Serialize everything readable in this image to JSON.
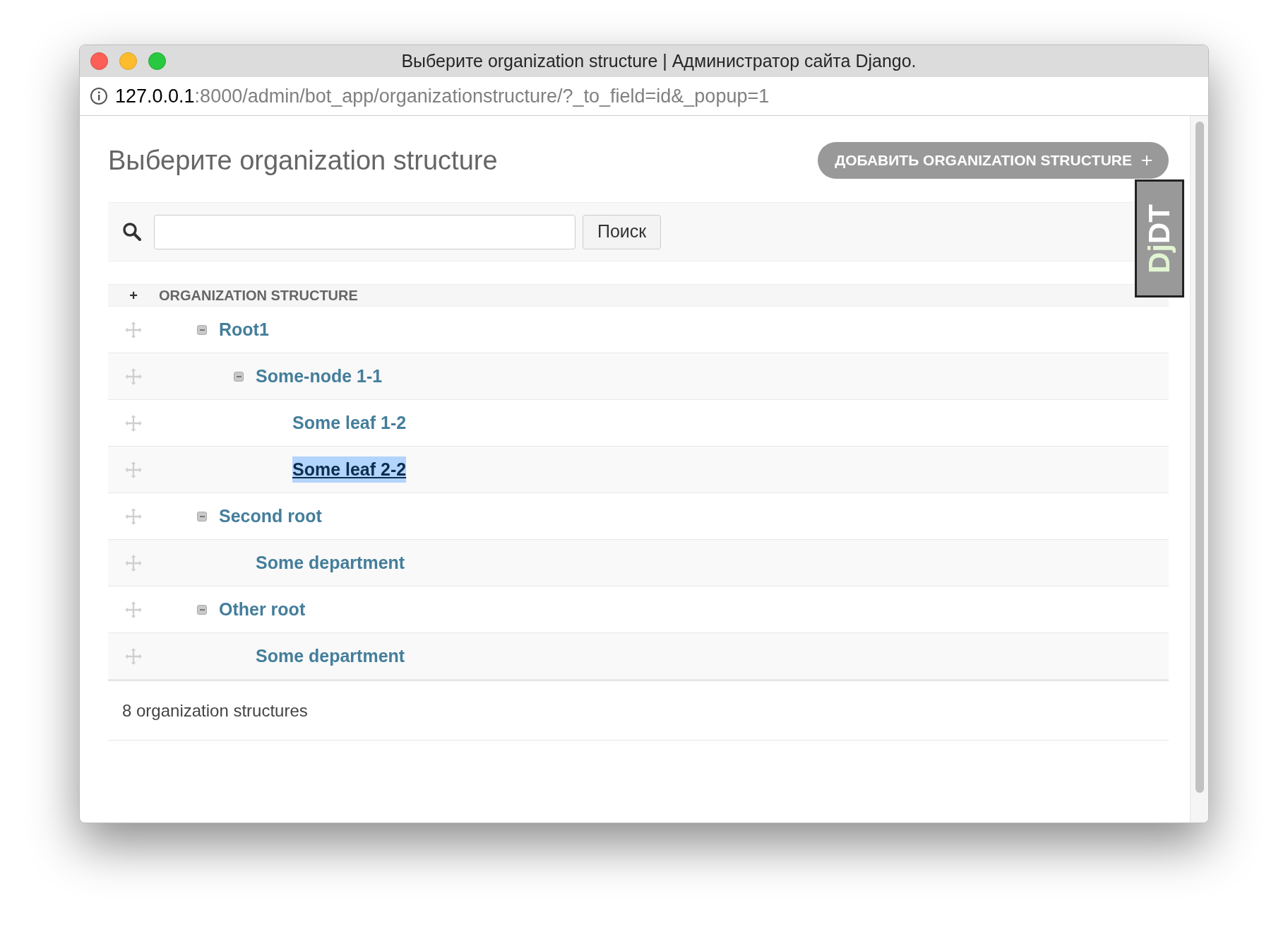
{
  "window": {
    "title": "Выберите organization structure | Администратор сайта Django."
  },
  "address_bar": {
    "host": "127.0.0.1",
    "path": ":8000/admin/bot_app/organizationstructure/?_to_field=id&_popup=1"
  },
  "page_title": "Выберите organization structure",
  "add_button": {
    "label": "ДОБАВИТЬ ORGANIZATION STRUCTURE"
  },
  "debug_toolbar_handle": {
    "label_start": "Dj",
    "label_end": "DT"
  },
  "search": {
    "button": "Поиск"
  },
  "table": {
    "expand_all": "+",
    "column": "ORGANIZATION STRUCTURE",
    "rows": [
      {
        "name": "Root1",
        "expanded": true,
        "selected": false,
        "children": [
          {
            "name": "Some-node 1-1",
            "expanded": true,
            "selected": false,
            "children": [
              {
                "name": "Some leaf 1-2",
                "selected": false
              },
              {
                "name": "Some leaf 2-2",
                "selected": true
              }
            ]
          }
        ]
      },
      {
        "name": "Second root",
        "expanded": true,
        "selected": false,
        "children": [
          {
            "name": "Some department",
            "selected": false
          }
        ]
      },
      {
        "name": "Other root",
        "expanded": true,
        "selected": false,
        "children": [
          {
            "name": "Some department",
            "selected": false
          }
        ]
      }
    ]
  },
  "result_count": "8 organization structures"
}
